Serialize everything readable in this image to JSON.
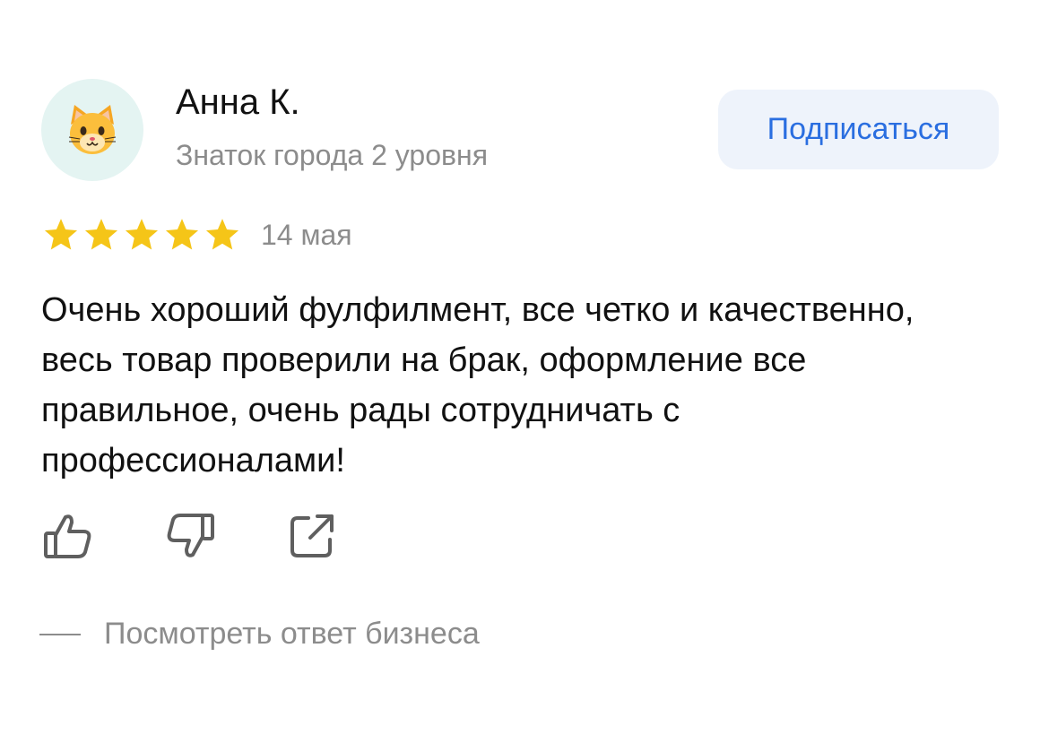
{
  "author": {
    "name": "Анна К.",
    "level": "Знаток города 2 уровня",
    "avatar_icon": "cat-face-emoji-icon"
  },
  "subscribe_label": "Подписаться",
  "rating": {
    "value": 5,
    "max": 5,
    "color": "#f5c518"
  },
  "date": "14 мая",
  "review_text": "Очень хороший фулфилмент, все четко и качественно, весь товар проверили на брак, оформление все правильное, очень рады сотрудничать с профессионалами!",
  "actions": [
    {
      "icon": "thumbs-up-icon"
    },
    {
      "icon": "thumbs-down-icon"
    },
    {
      "icon": "share-icon"
    }
  ],
  "business_reply_link": "Посмотреть ответ бизнеса",
  "colors": {
    "accent": "#2a6ee0",
    "button_bg": "#eef3fb",
    "muted": "#8c8c8c"
  }
}
